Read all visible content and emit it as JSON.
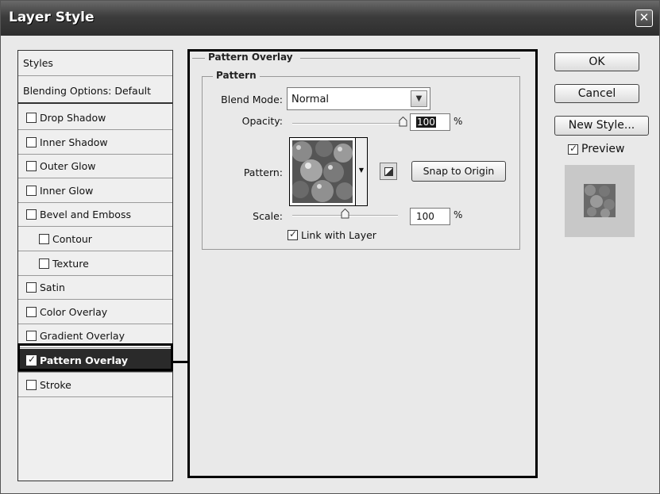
{
  "window": {
    "title": "Layer Style",
    "close": "✕"
  },
  "styles_list": {
    "header": "Styles",
    "blending": "Blending Options: Default",
    "items": [
      {
        "label": "Drop Shadow",
        "checked": false
      },
      {
        "label": "Inner Shadow",
        "checked": false
      },
      {
        "label": "Outer Glow",
        "checked": false
      },
      {
        "label": "Inner Glow",
        "checked": false
      },
      {
        "label": "Bevel and Emboss",
        "checked": false
      },
      {
        "label": "Contour",
        "checked": false,
        "sub": true
      },
      {
        "label": "Texture",
        "checked": false,
        "sub": true
      },
      {
        "label": "Satin",
        "checked": false
      },
      {
        "label": "Color Overlay",
        "checked": false
      },
      {
        "label": "Gradient Overlay",
        "checked": false
      },
      {
        "label": "Pattern Overlay",
        "checked": true,
        "selected": true
      },
      {
        "label": "Stroke",
        "checked": false
      }
    ]
  },
  "panel": {
    "section_title": "Pattern Overlay",
    "group_title": "Pattern",
    "blend_mode_label": "Blend Mode:",
    "blend_mode_value": "Normal",
    "opacity_label": "Opacity:",
    "opacity_value": "100",
    "opacity_unit": "%",
    "pattern_label": "Pattern:",
    "snap_button": "Snap to Origin",
    "scale_label": "Scale:",
    "scale_value": "100",
    "scale_unit": "%",
    "link_label": "Link with Layer",
    "link_checked": true,
    "opacity_level": 1.0,
    "scale_slider_level": 0.5
  },
  "buttons": {
    "ok": "OK",
    "cancel": "Cancel",
    "new_style": "New Style..."
  },
  "preview": {
    "label": "Preview",
    "checked": true
  }
}
